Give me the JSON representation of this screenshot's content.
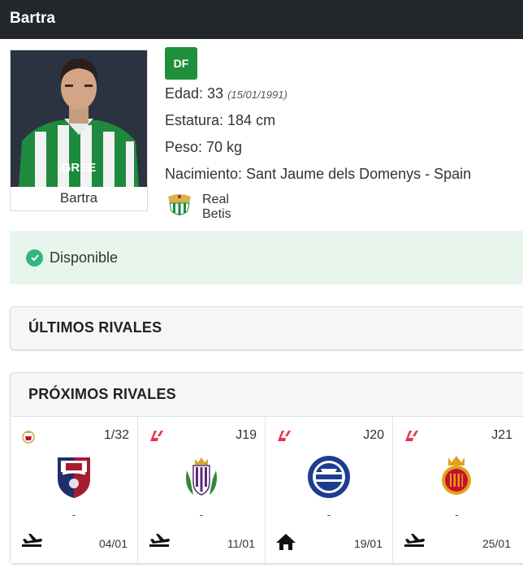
{
  "header": {
    "title": "Bartra"
  },
  "player": {
    "name": "Bartra",
    "position": "DF",
    "age_label": "Edad: 33",
    "birthdate": "(15/01/1991)",
    "height_label": "Estatura: 184 cm",
    "weight_label": "Peso: 70 kg",
    "birthplace_label": "Nacimiento: Sant Jaume dels Domenys - Spain",
    "team": "Real Betis",
    "shirt_sponsor": "GREE"
  },
  "status": {
    "label": "Disponible",
    "color": "#2fb87a"
  },
  "sections": {
    "last_rivals": "ÚLTIMOS RIVALES",
    "next_rivals": "PRÓXIMOS RIVALES"
  },
  "matches": [
    {
      "competition": "copa-del-rey-icon",
      "round": "1/32",
      "rival_crest": "huesca-crest",
      "score": "-",
      "venue": "away",
      "venue_icon": "plane-icon",
      "date": "04/01"
    },
    {
      "competition": "laliga-icon",
      "round": "J19",
      "rival_crest": "valladolid-crest",
      "score": "-",
      "venue": "away",
      "venue_icon": "plane-icon",
      "date": "11/01"
    },
    {
      "competition": "laliga-icon",
      "round": "J20",
      "rival_crest": "alaves-crest",
      "score": "-",
      "venue": "home",
      "venue_icon": "home-icon",
      "date": "19/01"
    },
    {
      "competition": "laliga-icon",
      "round": "J21",
      "rival_crest": "mallorca-crest",
      "score": "-",
      "venue": "away",
      "venue_icon": "plane-icon",
      "date": "25/01"
    }
  ],
  "colors": {
    "header": "#23272b",
    "position_badge": "#1f8f3a",
    "status_bg": "#e8f5ec",
    "laliga": "#e8324a"
  }
}
